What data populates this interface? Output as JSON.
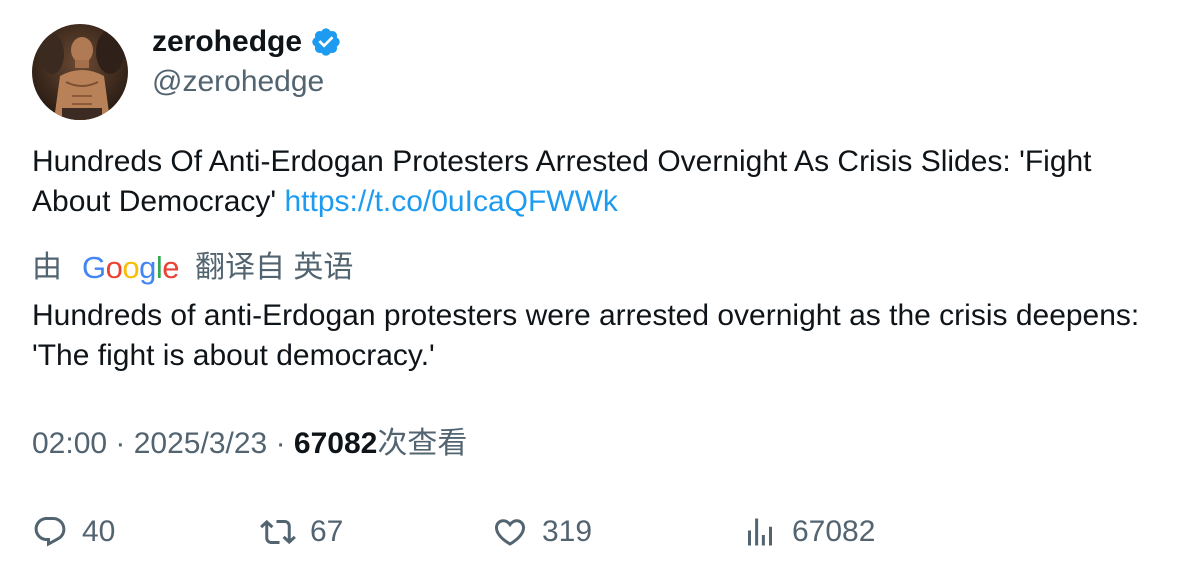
{
  "author": {
    "display_name": "zerohedge",
    "handle": "@zerohedge",
    "verified": true,
    "avatar_icon": "avatar-photo"
  },
  "tweet": {
    "text": "Hundreds Of Anti-Erdogan Protesters Arrested Overnight As Crisis Slides: 'Fight About Democracy' ",
    "link": "https://t.co/0uIcaQFWWk"
  },
  "translation": {
    "prefix": "由",
    "provider": "Google",
    "suffix": "翻译自 英语",
    "text": "Hundreds of anti-Erdogan protesters were arrested overnight as the crisis deepens: 'The fight is about democracy.'"
  },
  "meta": {
    "time": "02:00",
    "date": "2025/3/23",
    "views": "67082",
    "views_label": "次查看"
  },
  "actions": {
    "replies": "40",
    "retweets": "67",
    "likes": "319",
    "views": "67082"
  },
  "colors": {
    "text": "#0f1419",
    "secondary": "#536471",
    "link": "#1d9bf0",
    "verified": "#1d9bf0"
  }
}
